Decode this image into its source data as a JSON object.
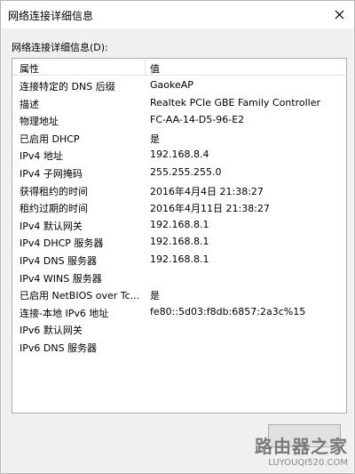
{
  "window": {
    "title": "网络连接详细信息"
  },
  "group": {
    "label": "网络连接详细信息(D):"
  },
  "columns": {
    "property": "属性",
    "value": "值"
  },
  "rows": [
    {
      "prop": "连接特定的 DNS 后缀",
      "val": "GaokeAP"
    },
    {
      "prop": "描述",
      "val": "Realtek PCIe GBE Family Controller"
    },
    {
      "prop": "物理地址",
      "val": "FC-AA-14-D5-96-E2"
    },
    {
      "prop": "已启用 DHCP",
      "val": "是"
    },
    {
      "prop": "IPv4 地址",
      "val": "192.168.8.4"
    },
    {
      "prop": "IPv4 子网掩码",
      "val": "255.255.255.0"
    },
    {
      "prop": "获得租约的时间",
      "val": "2016年4月4日 21:38:27"
    },
    {
      "prop": "租约过期的时间",
      "val": "2016年4月11日 21:38:27"
    },
    {
      "prop": "IPv4 默认网关",
      "val": "192.168.8.1"
    },
    {
      "prop": "IPv4 DHCP 服务器",
      "val": "192.168.8.1"
    },
    {
      "prop": "IPv4 DNS 服务器",
      "val": "192.168.8.1"
    },
    {
      "prop": "IPv4 WINS 服务器",
      "val": ""
    },
    {
      "prop": "已启用 NetBIOS over Tc...",
      "val": "是"
    },
    {
      "prop": "连接-本地 IPv6 地址",
      "val": "fe80::5d03:f8db:6857:2a3c%15"
    },
    {
      "prop": "IPv6 默认网关",
      "val": ""
    },
    {
      "prop": "IPv6 DNS 服务器",
      "val": ""
    }
  ],
  "watermark": {
    "main": "路由器之家",
    "sub": "LUYOUQI520.COM"
  }
}
